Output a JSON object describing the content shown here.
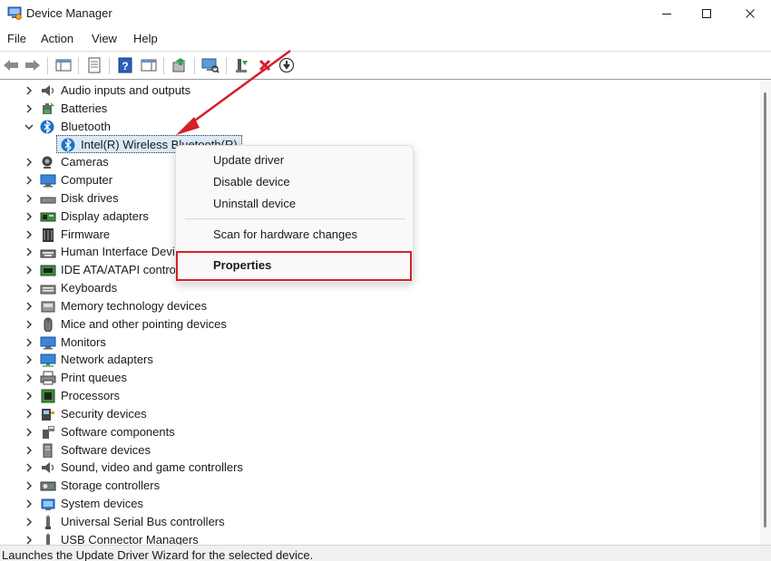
{
  "window": {
    "title": "Device Manager",
    "controls": [
      "minimize",
      "maximize",
      "close"
    ]
  },
  "menu": [
    "File",
    "Action",
    "View",
    "Help"
  ],
  "toolbar": {
    "buttons": [
      "back-arrow-icon",
      "forward-arrow-icon",
      "show-hide-console-tree-icon",
      "properties-icon",
      "help-icon",
      "show-action-pane-icon",
      "update-driver-icon",
      "scan-hardware-icon",
      "enable-device-icon",
      "uninstall-device-icon",
      "download-driver-icon"
    ]
  },
  "tree": {
    "categories": [
      {
        "label": "Audio inputs and outputs",
        "icon": "speaker-icon",
        "expanded": false
      },
      {
        "label": "Batteries",
        "icon": "battery-icon",
        "expanded": false
      },
      {
        "label": "Bluetooth",
        "icon": "bluetooth-icon",
        "expanded": true
      },
      {
        "label": "Cameras",
        "icon": "camera-icon",
        "expanded": false
      },
      {
        "label": "Computer",
        "icon": "monitor-icon",
        "expanded": false
      },
      {
        "label": "Disk drives",
        "icon": "disk-drive-icon",
        "expanded": false
      },
      {
        "label": "Display adapters",
        "icon": "display-adapter-icon",
        "expanded": false
      },
      {
        "label": "Firmware",
        "icon": "chip-icon",
        "expanded": false
      },
      {
        "label": "Human Interface Devi",
        "icon": "keyboard-hid-icon",
        "expanded": false
      },
      {
        "label": "IDE ATA/ATAPI contro",
        "icon": "ide-controller-icon",
        "expanded": false
      },
      {
        "label": "Keyboards",
        "icon": "keyboard-icon",
        "expanded": false
      },
      {
        "label": "Memory technology devices",
        "icon": "memory-card-icon",
        "expanded": false
      },
      {
        "label": "Mice and other pointing devices",
        "icon": "mouse-icon",
        "expanded": false
      },
      {
        "label": "Monitors",
        "icon": "monitor-icon",
        "expanded": false
      },
      {
        "label": "Network adapters",
        "icon": "network-icon",
        "expanded": false
      },
      {
        "label": "Print queues",
        "icon": "printer-icon",
        "expanded": false
      },
      {
        "label": "Processors",
        "icon": "processor-icon",
        "expanded": false
      },
      {
        "label": "Security devices",
        "icon": "security-icon",
        "expanded": false
      },
      {
        "label": "Software components",
        "icon": "software-component-icon",
        "expanded": false
      },
      {
        "label": "Software devices",
        "icon": "software-device-icon",
        "expanded": false
      },
      {
        "label": "Sound, video and game controllers",
        "icon": "speaker-icon",
        "expanded": false
      },
      {
        "label": "Storage controllers",
        "icon": "storage-controller-icon",
        "expanded": false
      },
      {
        "label": "System devices",
        "icon": "system-device-icon",
        "expanded": false
      },
      {
        "label": "Universal Serial Bus controllers",
        "icon": "usb-icon",
        "expanded": false
      },
      {
        "label": "USB Connector Managers",
        "icon": "usb-icon",
        "expanded": false
      }
    ],
    "bluetooth_child": {
      "label": "Intel(R) Wireless Bluetooth(R)",
      "icon": "bluetooth-icon"
    }
  },
  "context_menu": {
    "items": [
      "Update driver",
      "Disable device",
      "Uninstall device",
      "Scan for hardware changes",
      "Properties"
    ]
  },
  "status": "Launches the Update Driver Wizard for the selected device.",
  "colors": {
    "annotation_red": "#d4202a",
    "selection_blue": "#dbe9f8",
    "bluetooth_blue": "#1a73c8"
  }
}
